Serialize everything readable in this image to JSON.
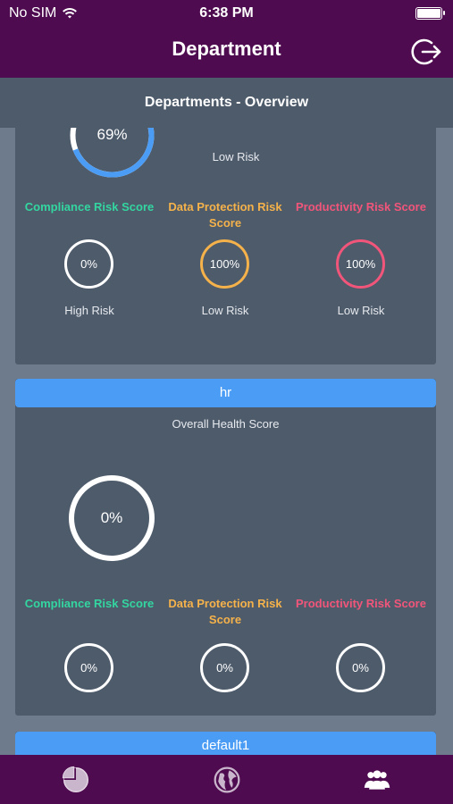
{
  "status": {
    "carrier": "No SIM",
    "time": "6:38 PM"
  },
  "nav": {
    "title": "Department"
  },
  "subheader": {
    "title": "Departments - Overview"
  },
  "dept1": {
    "overall_percent": "69%",
    "overall_value": 0.69,
    "overall_risk": "Low Risk",
    "scores": [
      {
        "title": "Compliance Risk Score",
        "value": "0%",
        "fraction": 0,
        "risk": "High Risk",
        "color": "#33d6a0"
      },
      {
        "title": "Data Protection Risk Score",
        "value": "100%",
        "fraction": 1,
        "risk": "Low Risk",
        "color": "#f5b24a"
      },
      {
        "title": "Productivity Risk Score",
        "value": "100%",
        "fraction": 1,
        "risk": "Low Risk",
        "color": "#f2557a"
      }
    ]
  },
  "dept2": {
    "name": "hr",
    "overall_label": "Overall Health Score",
    "overall_percent": "0%",
    "scores": [
      {
        "title": "Compliance Risk Score",
        "value": "0%",
        "color": "#33d6a0"
      },
      {
        "title": "Data Protection Risk Score",
        "value": "0%",
        "color": "#f5b24a"
      },
      {
        "title": "Productivity Risk Score",
        "value": "0%",
        "color": "#f2557a"
      }
    ]
  },
  "dept3": {
    "name": "default1"
  },
  "tabs": [
    {
      "icon": "pie-chart-icon",
      "active": false
    },
    {
      "icon": "globe-icon",
      "active": false
    },
    {
      "icon": "users-icon",
      "active": true
    }
  ],
  "colors": {
    "nav_bg": "#4e0b4f",
    "card_bg": "#4e5b6b",
    "accent_blue": "#4a9cf5"
  }
}
